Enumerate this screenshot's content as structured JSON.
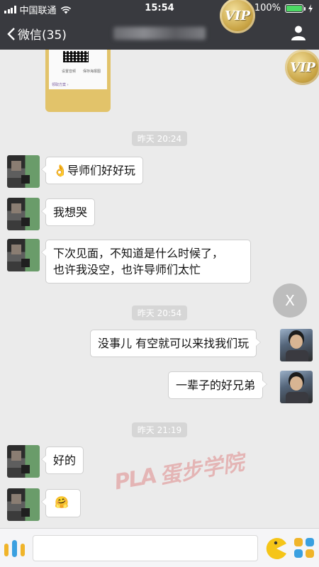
{
  "status_bar": {
    "carrier": "中国联通",
    "time": "15:54",
    "battery": "100%",
    "battery_level": 1.0
  },
  "nav": {
    "back_label": "微信(35)",
    "badge": "VIP"
  },
  "shared_card": {
    "line_left": "设置音频",
    "line_right": "保存海报图",
    "footer": "领取方案 ›"
  },
  "messages": [
    {
      "type": "timestamp",
      "text": "昨天 20:24"
    },
    {
      "type": "received",
      "emoji": "👌",
      "text": "导师们好好玩"
    },
    {
      "type": "received",
      "text": "我想哭"
    },
    {
      "type": "received",
      "lines": [
        "下次见面，不知道是什么时候了，",
        "也许我没空，也许导师们太忙"
      ]
    },
    {
      "type": "timestamp",
      "text": "昨天 20:54"
    },
    {
      "type": "sent",
      "text": "没事儿 有空就可以来找我们玩"
    },
    {
      "type": "sent",
      "text": "一辈子的好兄弟"
    },
    {
      "type": "timestamp",
      "text": "昨天 21:19"
    },
    {
      "type": "received",
      "text": "好的"
    },
    {
      "type": "received",
      "emoji": "🤗"
    }
  ],
  "close_button": {
    "label": "X"
  },
  "watermark": {
    "logo": "PLA",
    "text": "蛋步学院"
  },
  "input_bar": {
    "value": ""
  },
  "colors": {
    "bar": "#393a3f",
    "chat_bg": "#ebebeb",
    "battery_green": "#4cd964",
    "vip_gold": "#c9a445"
  }
}
